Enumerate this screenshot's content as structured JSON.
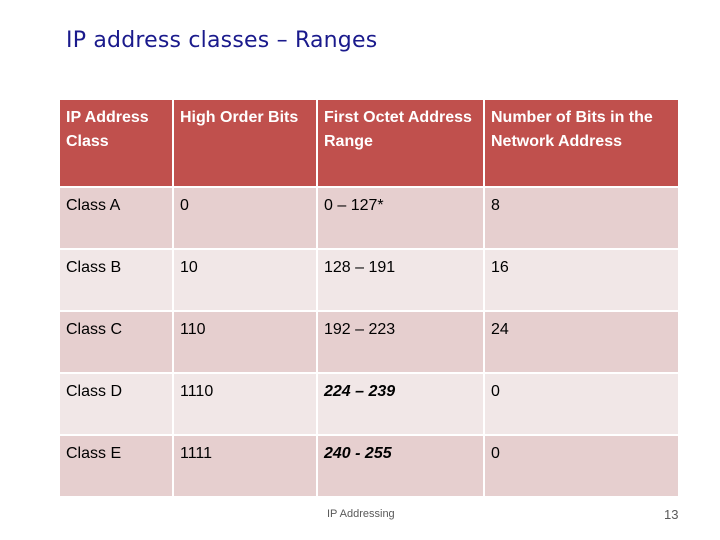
{
  "slide": {
    "title": "IP address classes – Ranges",
    "footer_text": "IP Addressing",
    "page_number": "13"
  },
  "table": {
    "headers": [
      "IP Address Class",
      "High Order Bits",
      "First Octet Address Range",
      "Number of Bits in the Network Address"
    ],
    "rows": [
      {
        "cls": "Class A",
        "bits": "0",
        "range": "0 – 127*",
        "net_bits": "8",
        "range_emphasis": false
      },
      {
        "cls": "Class B",
        "bits": "10",
        "range": "128 – 191",
        "net_bits": "16",
        "range_emphasis": false
      },
      {
        "cls": "Class C",
        "bits": "110",
        "range": "192 – 223",
        "net_bits": "24",
        "range_emphasis": false
      },
      {
        "cls": "Class D",
        "bits": "1110",
        "range": "224 – 239",
        "net_bits": "0",
        "range_emphasis": true
      },
      {
        "cls": "Class E",
        "bits": "1111",
        "range": "240 - 255",
        "net_bits": "0",
        "range_emphasis": true
      }
    ]
  },
  "colors": {
    "title": "#1a1a8c",
    "header_bg": "#c0504d",
    "row_odd_bg": "#e6cfcf",
    "row_even_bg": "#f1e7e7"
  }
}
